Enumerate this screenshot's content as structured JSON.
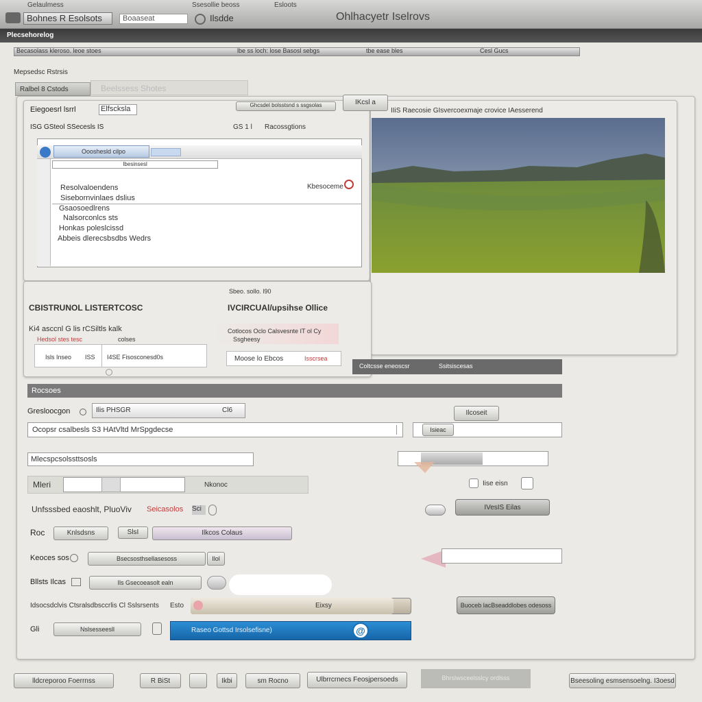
{
  "titlebar": {
    "app_title": "Bohnes R Esolsots",
    "search_placeholder": "Boaaseat",
    "tab_label": "Ilsdde",
    "window_title": "Ohlhacyetr Iselrovs",
    "top_menu_1": "Gelaulmess",
    "top_menu_2": "Ssesollie beoss",
    "top_menu_3": "Esloots"
  },
  "menubar": {
    "label": "Plecsehorelog"
  },
  "address": {
    "segment_1": "Becasolass kleroso.  leoe stoes",
    "segment_2": "lbe ss loch:  lose  Basosl  sebgs",
    "segment_3": "tbe  ease  bles",
    "segment_4": "Cesl  Gucs"
  },
  "page": {
    "subtitle": "Mepsedsc Rstrsis",
    "tab_1": "Ralbel 8 Cstods",
    "tab_2": "Beelssess  Shotes"
  },
  "browser_panel": {
    "row1_label": "Eiegoesrl  lsrrl",
    "row1_field": "Elfscksla",
    "row1_button": "Ghcsdel  bolsstsnd  s  ssgsolas",
    "row2_label": "ISG  GSteol  SSecesls  IS",
    "row2_value": "GS 1 l",
    "row2_right": "Racossgtions",
    "inner_tab": "Oooshesld cilpo",
    "inner_address": "Ibesinsesl",
    "list_items": [
      "Resolvaloendens",
      "Sisebornvinlaes  dslius",
      "Gsaosoedlrens",
      "Nalsorconlcs sts",
      "Honkas poleslcissd",
      "Abbeis dlerecsbsdbs Wedrs"
    ],
    "list_badge": "Kbesoceme"
  },
  "image_panel": {
    "label": "IKcsl  a",
    "caption": "IIiS  Raecosie  GIsvercoexmaje  crovice  IAesserend"
  },
  "mid_panel": {
    "heading": "CBISTRUNOL   LISTERTCOSC",
    "line1": "Ki4 asccnl G  lis  rCSiltls  kalk",
    "line2": "Hedsol stes  tesc",
    "line2b": "colses",
    "cell1": "Isls  Inseo",
    "cell2": "ISS",
    "cell3": "I4SE  Fisosconesd0s",
    "top_right": "Sbeo.  sollo.  l90",
    "right_heading": "IVCIRCUAl/upsihse Ollice",
    "right_line": "Cotlocos Oclo  Calsvesnte IT  ol Cy",
    "right_line2": "Ssgheesy",
    "right_cell1": "Moose  lo  Ebcos",
    "right_cell2": "Isscrsea"
  },
  "section_tabs": {
    "tab_1": "Coltcsse eneoscsr",
    "tab_2": "Ssitsiscesas"
  },
  "form": {
    "section_title": "Rocsoes",
    "row1_label": "Gresloocgon",
    "row1_value": "Ilis  PHSGR",
    "row1_value_end": "Cl6",
    "row1_button": "Ilcoseit",
    "row2_field": "Ocopsr csalbesls  S3 HAtVltd MrSpgdecse",
    "row2_btn": "Isieac",
    "row3_field": "Mlecspcsolssttsosls",
    "row4_label": "Mleri",
    "row4_value": "Nkonoc",
    "row4_right": "Iise  eisn",
    "row5_label": "Unfsssbed  eaoshlt,  PluoViv",
    "row5_red": "Seicasolos",
    "row5_num": "Sci",
    "row5_btn": "IVesIS  Eilas",
    "row6_label": "Roc",
    "row6_sel1": "Knlsdsns",
    "row6_sel2": "SlsI",
    "row6_sel3": "Ilkcos  Colaus",
    "row7_label": "Keoces sos",
    "row7_field": "Bsecsosthsellasesoss",
    "row7_end": "Ilol",
    "row8_label": "Bllsts  Ilcas",
    "row8_field": "Ils  Gsecoeasolt  ealn",
    "row9_label": "Idsocsdclvis  Ctsralsdbsccrlis  Cl  Sslsrsents",
    "row9_mid": "Esto",
    "row9_progress": "Eixsy",
    "row9_btn": "Buoceb  lacBseaddlobes  odesoss",
    "row10_label": "Gli",
    "row10_field": "Nslsesseesll",
    "row10_blue": "Raseo  Gottsd  Irsolsefisne)",
    "progress_fraction": 0.92
  },
  "footer": {
    "btn_1": "lldcreporoo  Foerrnss",
    "btn_2": "R  BiSt",
    "btn_3": "Ikbi",
    "btn_4": "sm  Rocno",
    "btn_5": "Ulbrrcrnecs  Feosjpersoeds",
    "btn_6": "Bhrslwsceelsslcy  ordlsss",
    "btn_7": "Bseesoling  esmsensoelng.  I3oesd"
  },
  "colors": {
    "accent_blue": "#1e78c8",
    "dark_bar": "#6a6a6a",
    "red_accent": "#c23a3a"
  },
  "icons": [
    "app-icon",
    "search-icon",
    "tab-icon",
    "globe-icon",
    "close-icon",
    "dropdown-icon",
    "arrow-icon",
    "at-icon",
    "radio-icon",
    "checkbox-icon"
  ]
}
